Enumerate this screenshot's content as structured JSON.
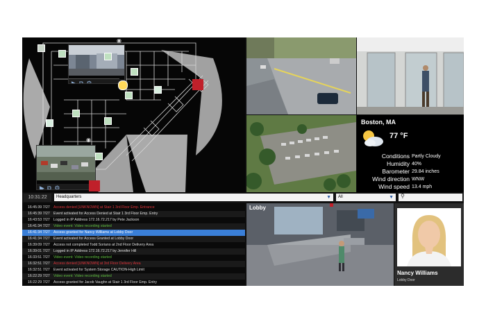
{
  "clock": "10:31:22",
  "site_selector": {
    "value": "Headquarters"
  },
  "filter_selector": {
    "value": "All"
  },
  "search": {
    "placeholder": ""
  },
  "weather": {
    "city": "Boston, MA",
    "temperature": "77 °F",
    "rows": [
      {
        "label": "Conditions",
        "value": "Partly Cloudy"
      },
      {
        "label": "Humidity",
        "value": "40%"
      },
      {
        "label": "Barometer",
        "value": "29.84 inches"
      },
      {
        "label": "Wind direction",
        "value": "WNW"
      },
      {
        "label": "Wind speed",
        "value": "13.4 mph"
      }
    ]
  },
  "lobby": {
    "title": "Lobby"
  },
  "person": {
    "name": "Nancy Williams",
    "location": "Lobby Door"
  },
  "events": [
    {
      "time": "16:45:39 7/27",
      "text": "Access denied [UNKNOWN] at Stair 1 3rd Floor Emp. Entrance",
      "style": "red"
    },
    {
      "time": "16:45:39 7/27",
      "text": "Event activated for Access Denied at Stair 1 3rd Floor Emp. Entry",
      "style": "normal"
    },
    {
      "time": "16:43:53 7/27",
      "text": "Logged in IP Address 172.16.72.217 by Pete Jackson",
      "style": "normal"
    },
    {
      "time": "16:41:34 7/27",
      "text": "Video event: Video recording started",
      "style": "green"
    },
    {
      "time": "16:41:34 7/27",
      "text": "Access granted for Nancy Williams at Lobby Door",
      "style": "selected"
    },
    {
      "time": "16:41:34 7/27",
      "text": "Event activated for Access Granted at Lobby Door",
      "style": "normal"
    },
    {
      "time": "16:39:09 7/27",
      "text": "Access not completed Todd Soriano at 2nd Floor Delivery Area",
      "style": "normal"
    },
    {
      "time": "16:39:01 7/27",
      "text": "Logged in IP Address 172.16.72.217 by Jennifer Hill",
      "style": "normal"
    },
    {
      "time": "16:33:51 7/27",
      "text": "Video event: Video recording started",
      "style": "green"
    },
    {
      "time": "16:32:51 7/27",
      "text": "Access denied [UNKNOWN] at 3rd Floor Delivery Area",
      "style": "red"
    },
    {
      "time": "16:32:51 7/27",
      "text": "Event activated for System Storage CAUTION-High Limit",
      "style": "normal"
    },
    {
      "time": "16:22:29 7/27",
      "text": "Video event: Video recording started",
      "style": "green"
    },
    {
      "time": "16:22:29 7/27",
      "text": "Access granted for Jacob Vaughn at Stair 1 3rd Floor Emp. Entry",
      "style": "normal"
    }
  ],
  "colors": {
    "accent": "#3a7fd8",
    "alarm": "#c0202a",
    "ok": "#5fbf3f"
  }
}
